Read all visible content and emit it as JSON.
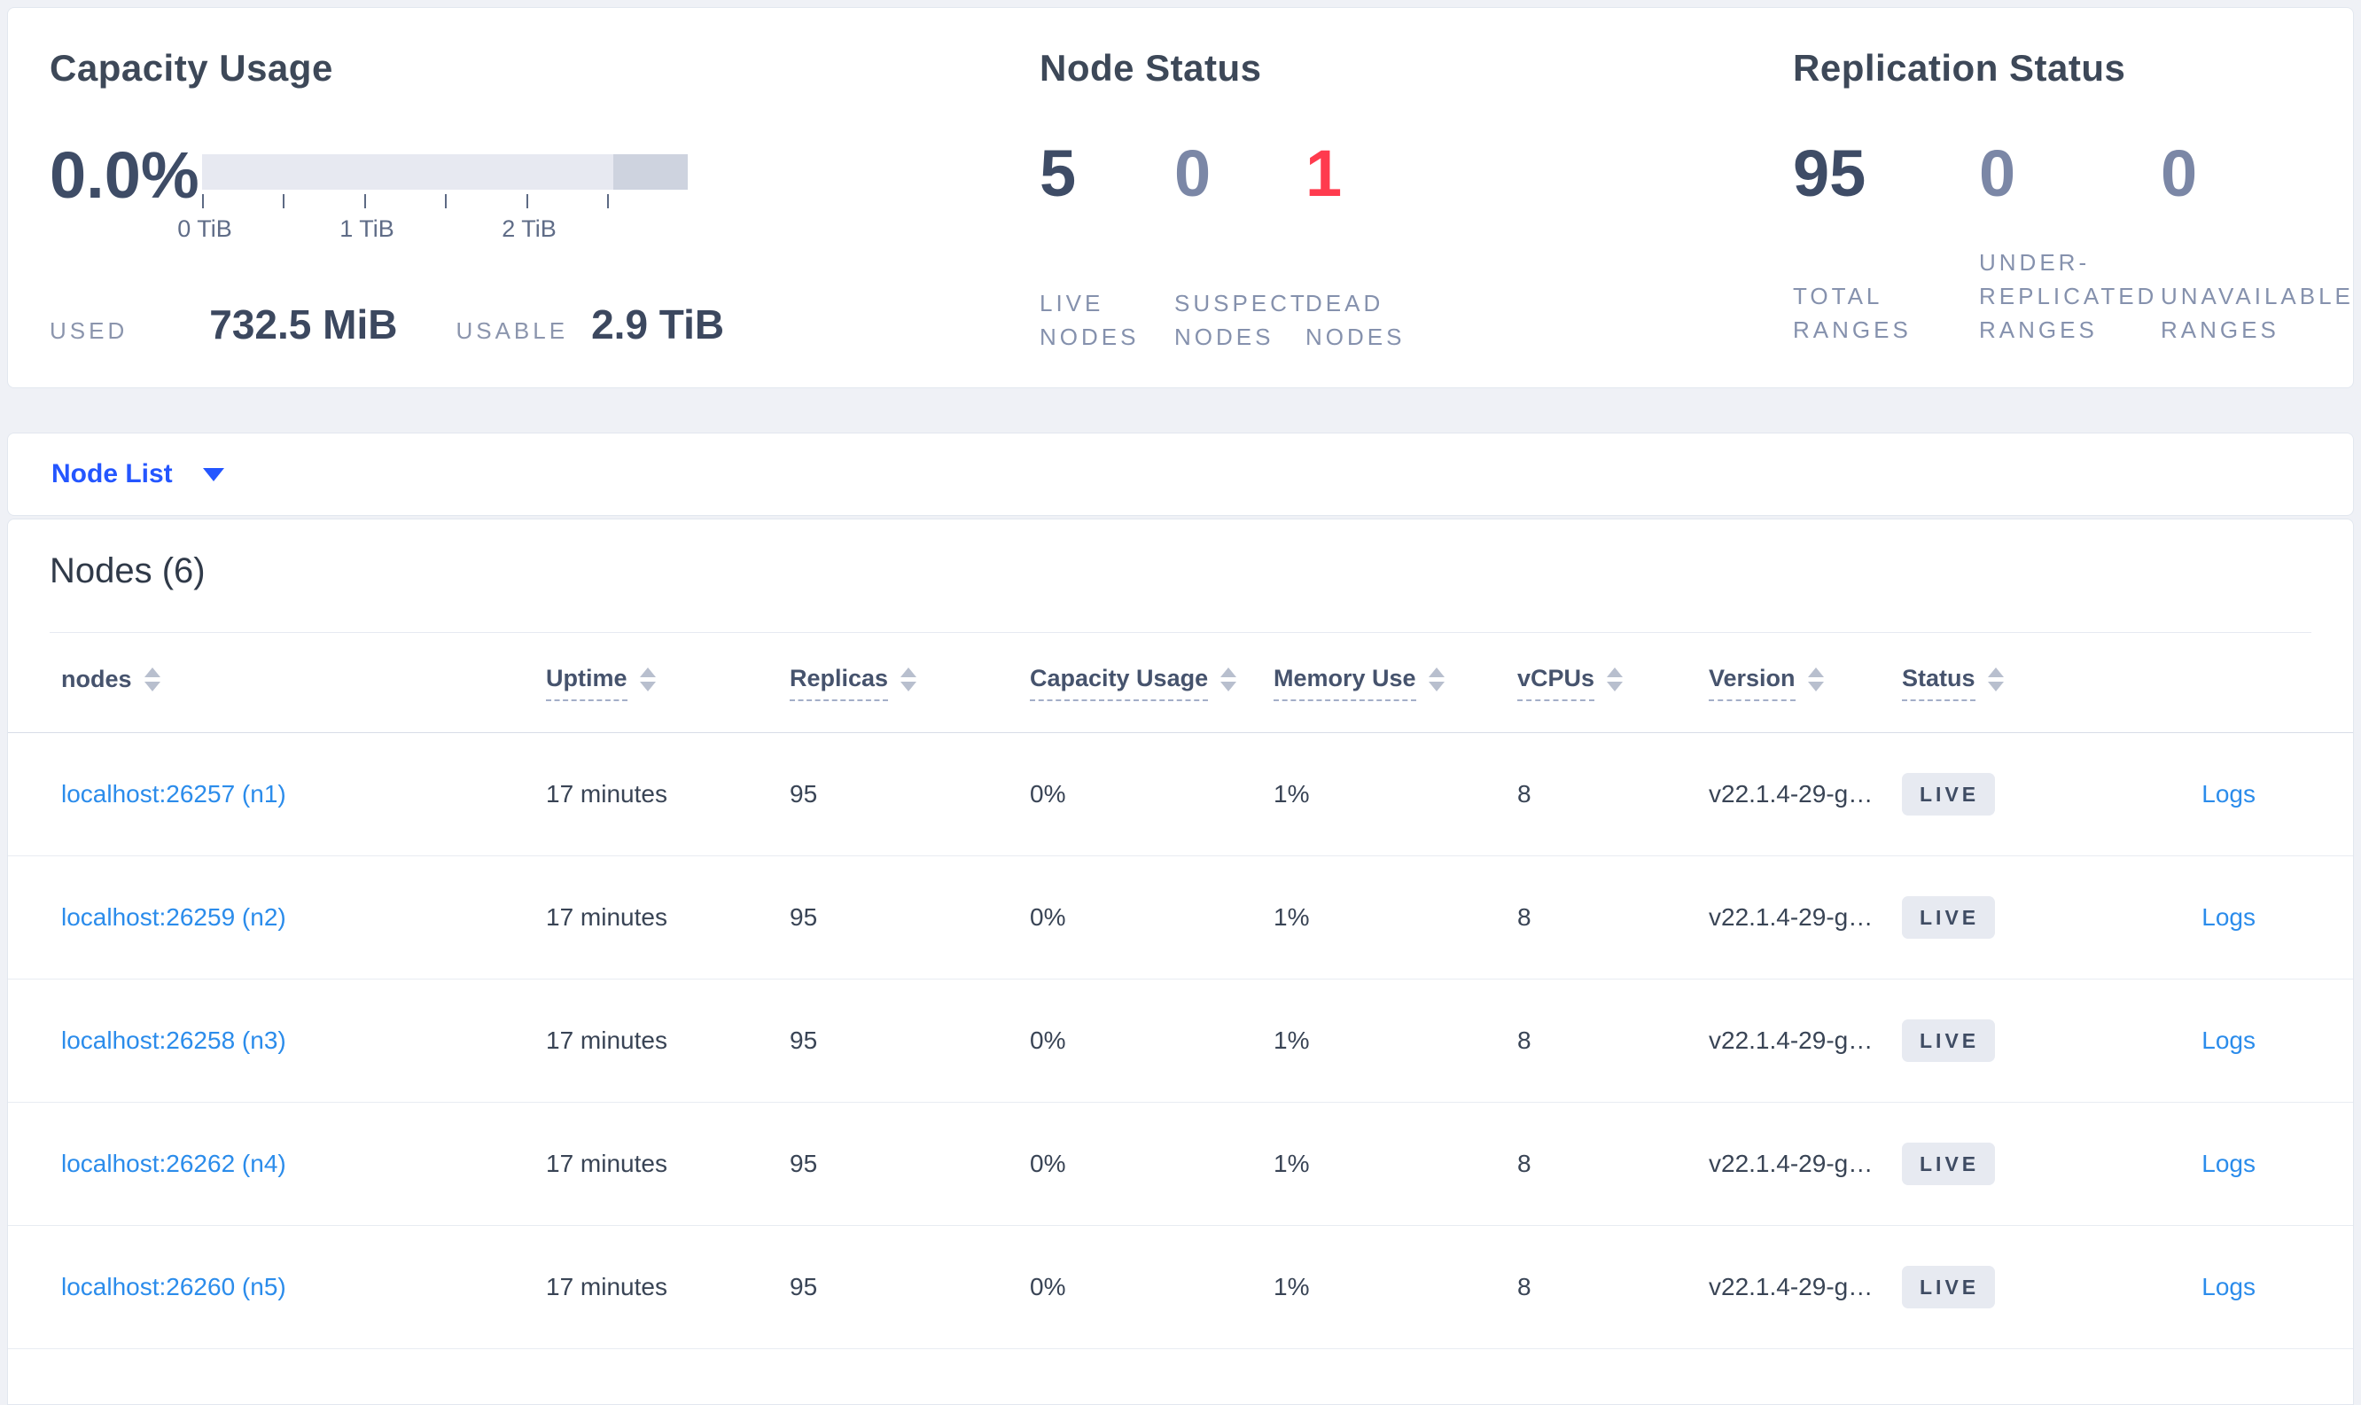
{
  "colors": {
    "page_bg": "#eff1f6",
    "card_border": "#e2e7ef",
    "heading": "#3d4858",
    "number_dark": "#3e4c66",
    "number_muted": "#7b87a6",
    "number_danger": "#ff3b4e",
    "label_muted": "#8591ad",
    "bar_light": "#e7e9f1",
    "bar_dark": "#ced3df",
    "selector_blue": "#2456ff",
    "link_blue": "#2b8ceb",
    "badge_bg": "#e7eaf1",
    "badge_text": "#3f4c63"
  },
  "capacity": {
    "title": "Capacity Usage",
    "percent": "0.0%",
    "tick_labels": [
      "0 TiB",
      "1 TiB",
      "2 TiB"
    ],
    "used_label": "USED",
    "used_value": "732.5 MiB",
    "usable_label": "USABLE",
    "usable_value": "2.9 TiB"
  },
  "node_status": {
    "title": "Node Status",
    "stats": [
      {
        "value": "5",
        "label": "LIVE NODES"
      },
      {
        "value": "0",
        "label": "SUSPECT NODES"
      },
      {
        "value": "1",
        "label": "DEAD NODES"
      }
    ]
  },
  "replication_status": {
    "title": "Replication Status",
    "stats": [
      {
        "value": "95",
        "label": "TOTAL RANGES"
      },
      {
        "value": "0",
        "label": "UNDER-REPLICATED RANGES"
      },
      {
        "value": "0",
        "label": "UNAVAILABLE RANGES"
      }
    ]
  },
  "view_selector": {
    "label": "Node List"
  },
  "nodes_table": {
    "title": "Nodes (6)",
    "columns": [
      {
        "label": "nodes"
      },
      {
        "label": "Uptime"
      },
      {
        "label": "Replicas"
      },
      {
        "label": "Capacity Usage"
      },
      {
        "label": "Memory Use"
      },
      {
        "label": "vCPUs"
      },
      {
        "label": "Version"
      },
      {
        "label": "Status"
      }
    ],
    "rows": [
      {
        "node": "localhost:26257 (n1)",
        "uptime": "17 minutes",
        "replicas": "95",
        "capacity": "0%",
        "memory": "1%",
        "vcpus": "8",
        "version": "v22.1.4-29-g…",
        "status": "LIVE",
        "logs": "Logs"
      },
      {
        "node": "localhost:26259 (n2)",
        "uptime": "17 minutes",
        "replicas": "95",
        "capacity": "0%",
        "memory": "1%",
        "vcpus": "8",
        "version": "v22.1.4-29-g…",
        "status": "LIVE",
        "logs": "Logs"
      },
      {
        "node": "localhost:26258 (n3)",
        "uptime": "17 minutes",
        "replicas": "95",
        "capacity": "0%",
        "memory": "1%",
        "vcpus": "8",
        "version": "v22.1.4-29-g…",
        "status": "LIVE",
        "logs": "Logs"
      },
      {
        "node": "localhost:26262 (n4)",
        "uptime": "17 minutes",
        "replicas": "95",
        "capacity": "0%",
        "memory": "1%",
        "vcpus": "8",
        "version": "v22.1.4-29-g…",
        "status": "LIVE",
        "logs": "Logs"
      },
      {
        "node": "localhost:26260 (n5)",
        "uptime": "17 minutes",
        "replicas": "95",
        "capacity": "0%",
        "memory": "1%",
        "vcpus": "8",
        "version": "v22.1.4-29-g…",
        "status": "LIVE",
        "logs": "Logs"
      }
    ]
  }
}
